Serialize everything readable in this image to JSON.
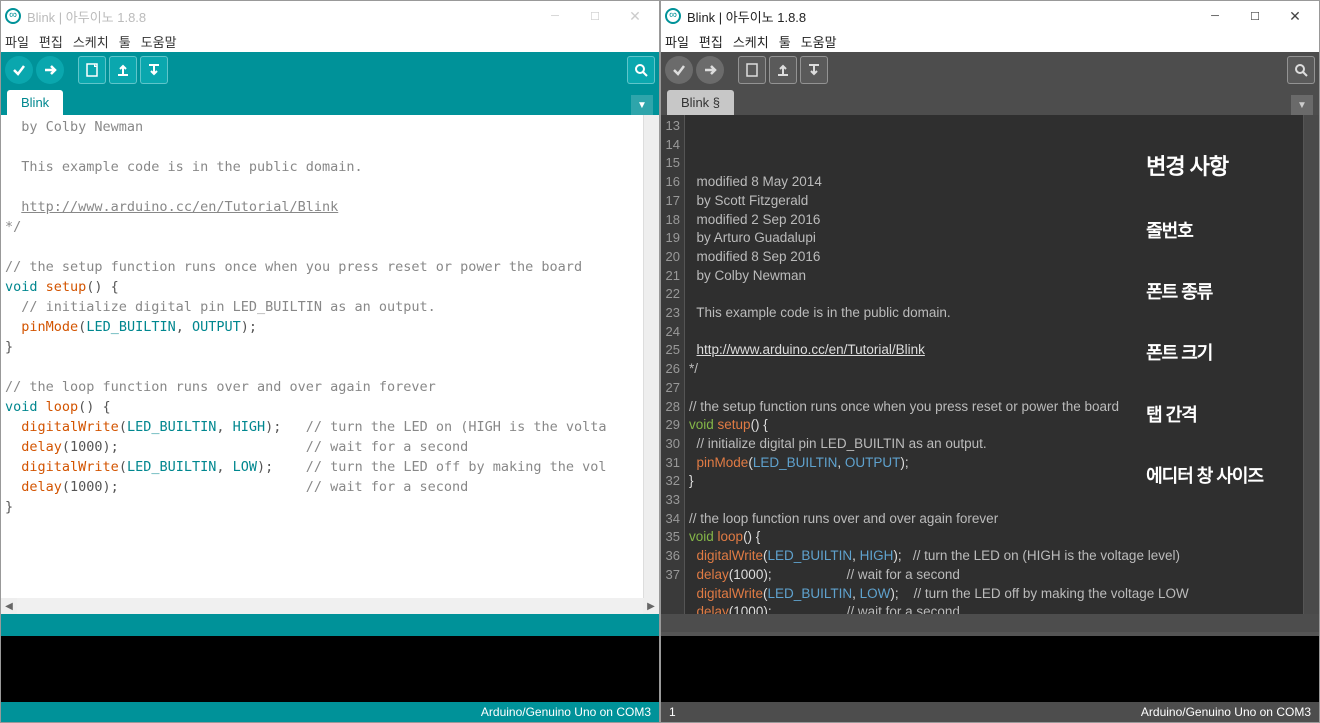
{
  "title": "Blink | 아두이노 1.8.8",
  "menu": [
    "파일",
    "편집",
    "스케치",
    "툴",
    "도움말"
  ],
  "tab_left": "Blink",
  "tab_right": "Blink §",
  "status_right": "Arduino/Genuino Uno on COM3",
  "status_line_right": "1",
  "overlay": {
    "title": "변경 사항",
    "items": [
      "줄번호",
      "폰트 종류",
      "폰트 크기",
      "탭 간격",
      "에디터 창 사이즈"
    ]
  },
  "left_code": [
    {
      "t": "  by Colby Newman",
      "cls": "cm"
    },
    {
      "t": "",
      "cls": ""
    },
    {
      "t": "  This example code is in the public domain.",
      "cls": "cm"
    },
    {
      "t": "",
      "cls": ""
    },
    {
      "t": "  http://www.arduino.cc/en/Tutorial/Blink",
      "cls": "url",
      "indent": "  "
    },
    {
      "t": "*/",
      "cls": "cm"
    },
    {
      "t": "",
      "cls": ""
    },
    {
      "t": "// the setup function runs once when you press reset or power the board",
      "cls": "cm"
    },
    {
      "seg": [
        [
          "kw",
          "void "
        ],
        [
          "fn",
          "setup"
        ],
        [
          "pl",
          "() {"
        ]
      ]
    },
    {
      "t": "  // initialize digital pin LED_BUILTIN as an output.",
      "cls": "cm"
    },
    {
      "seg": [
        [
          "pl",
          "  "
        ],
        [
          "fn",
          "pinMode"
        ],
        [
          "pl",
          "("
        ],
        [
          "co",
          "LED_BUILTIN"
        ],
        [
          "pl",
          ", "
        ],
        [
          "co",
          "OUTPUT"
        ],
        [
          "pl",
          ");"
        ]
      ]
    },
    {
      "t": "}",
      "cls": "pl"
    },
    {
      "t": "",
      "cls": ""
    },
    {
      "t": "// the loop function runs over and over again forever",
      "cls": "cm"
    },
    {
      "seg": [
        [
          "kw",
          "void "
        ],
        [
          "fn",
          "loop"
        ],
        [
          "pl",
          "() {"
        ]
      ]
    },
    {
      "seg": [
        [
          "pl",
          "  "
        ],
        [
          "fn",
          "digitalWrite"
        ],
        [
          "pl",
          "("
        ],
        [
          "co",
          "LED_BUILTIN"
        ],
        [
          "pl",
          ", "
        ],
        [
          "co",
          "HIGH"
        ],
        [
          "pl",
          ");   "
        ],
        [
          "cm",
          "// turn the LED on (HIGH is the volta"
        ]
      ]
    },
    {
      "seg": [
        [
          "pl",
          "  "
        ],
        [
          "fn",
          "delay"
        ],
        [
          "pl",
          "(1000);                       "
        ],
        [
          "cm",
          "// wait for a second"
        ]
      ]
    },
    {
      "seg": [
        [
          "pl",
          "  "
        ],
        [
          "fn",
          "digitalWrite"
        ],
        [
          "pl",
          "("
        ],
        [
          "co",
          "LED_BUILTIN"
        ],
        [
          "pl",
          ", "
        ],
        [
          "co",
          "LOW"
        ],
        [
          "pl",
          ");    "
        ],
        [
          "cm",
          "// turn the LED off by making the vol"
        ]
      ]
    },
    {
      "seg": [
        [
          "pl",
          "  "
        ],
        [
          "fn",
          "delay"
        ],
        [
          "pl",
          "(1000);                       "
        ],
        [
          "cm",
          "// wait for a second"
        ]
      ]
    },
    {
      "t": "}",
      "cls": "pl"
    }
  ],
  "right_start_line": 13,
  "right_code": [
    {
      "t": "  modified 8 May 2014",
      "cls": "cm"
    },
    {
      "t": "  by Scott Fitzgerald",
      "cls": "cm"
    },
    {
      "t": "  modified 2 Sep 2016",
      "cls": "cm"
    },
    {
      "t": "  by Arturo Guadalupi",
      "cls": "cm"
    },
    {
      "t": "  modified 8 Sep 2016",
      "cls": "cm"
    },
    {
      "t": "  by Colby Newman",
      "cls": "cm"
    },
    {
      "t": "",
      "cls": ""
    },
    {
      "t": "  This example code is in the public domain.",
      "cls": "cm"
    },
    {
      "t": "",
      "cls": ""
    },
    {
      "t": "  http://www.arduino.cc/en/Tutorial/Blink",
      "cls": "url",
      "indent": "  "
    },
    {
      "t": "*/",
      "cls": "cm"
    },
    {
      "t": "",
      "cls": ""
    },
    {
      "t": "// the setup function runs once when you press reset or power the board",
      "cls": "cm"
    },
    {
      "seg": [
        [
          "kw",
          "void "
        ],
        [
          "fn",
          "setup"
        ],
        [
          "pl",
          "() {"
        ]
      ]
    },
    {
      "t": "  // initialize digital pin LED_BUILTIN as an output.",
      "cls": "cm"
    },
    {
      "seg": [
        [
          "pl",
          "  "
        ],
        [
          "fn",
          "pinMode"
        ],
        [
          "pl",
          "("
        ],
        [
          "co",
          "LED_BUILTIN"
        ],
        [
          "pl",
          ", "
        ],
        [
          "co",
          "OUTPUT"
        ],
        [
          "pl",
          ");"
        ]
      ]
    },
    {
      "t": "}",
      "cls": "pl"
    },
    {
      "t": "",
      "cls": ""
    },
    {
      "t": "// the loop function runs over and over again forever",
      "cls": "cm"
    },
    {
      "seg": [
        [
          "kw",
          "void "
        ],
        [
          "fn",
          "loop"
        ],
        [
          "pl",
          "() {"
        ]
      ]
    },
    {
      "seg": [
        [
          "pl",
          "  "
        ],
        [
          "fn",
          "digitalWrite"
        ],
        [
          "pl",
          "("
        ],
        [
          "co",
          "LED_BUILTIN"
        ],
        [
          "pl",
          ", "
        ],
        [
          "co",
          "HIGH"
        ],
        [
          "pl",
          ");   "
        ],
        [
          "cm",
          "// turn the LED on (HIGH is the voltage level)"
        ]
      ]
    },
    {
      "seg": [
        [
          "pl",
          "  "
        ],
        [
          "fn",
          "delay"
        ],
        [
          "pl",
          "(1000);                    "
        ],
        [
          "cm",
          "// wait for a second"
        ]
      ]
    },
    {
      "seg": [
        [
          "pl",
          "  "
        ],
        [
          "fn",
          "digitalWrite"
        ],
        [
          "pl",
          "("
        ],
        [
          "co",
          "LED_BUILTIN"
        ],
        [
          "pl",
          ", "
        ],
        [
          "co",
          "LOW"
        ],
        [
          "pl",
          ");    "
        ],
        [
          "cm",
          "// turn the LED off by making the voltage LOW"
        ]
      ]
    },
    {
      "seg": [
        [
          "pl",
          "  "
        ],
        [
          "fn",
          "delay"
        ],
        [
          "pl",
          "(1000);                    "
        ],
        [
          "cm",
          "// wait for a second"
        ]
      ]
    },
    {
      "t": "}",
      "cls": "pl"
    }
  ]
}
